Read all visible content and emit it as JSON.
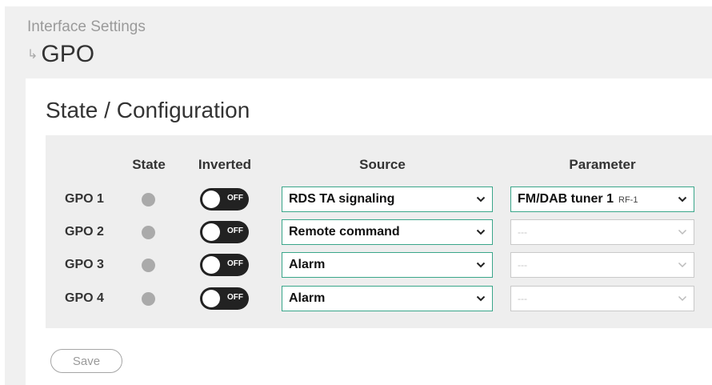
{
  "breadcrumb": {
    "parent": "Interface Settings",
    "arrow": "↳",
    "current": "GPO"
  },
  "section": {
    "title": "State / Configuration"
  },
  "columns": {
    "state": "State",
    "inverted": "Inverted",
    "source": "Source",
    "parameter": "Parameter"
  },
  "rows": [
    {
      "label": "GPO 1",
      "toggle": "OFF",
      "source": "RDS TA signaling",
      "parameter": "FM/DAB tuner 1",
      "parameter_sub": "RF-1"
    },
    {
      "label": "GPO 2",
      "toggle": "OFF",
      "source": "Remote command",
      "parameter": "---"
    },
    {
      "label": "GPO 3",
      "toggle": "OFF",
      "source": "Alarm",
      "parameter": "---"
    },
    {
      "label": "GPO 4",
      "toggle": "OFF",
      "source": "Alarm",
      "parameter": "---"
    }
  ],
  "save_label": "Save",
  "colors": {
    "accent_border": "#3aa68a",
    "state_dot": "#aaaaaa",
    "toggle_bg": "#222222"
  },
  "icons": {
    "dropdown": "chevron-down-icon",
    "breadcrumb": "return-arrow-icon"
  }
}
